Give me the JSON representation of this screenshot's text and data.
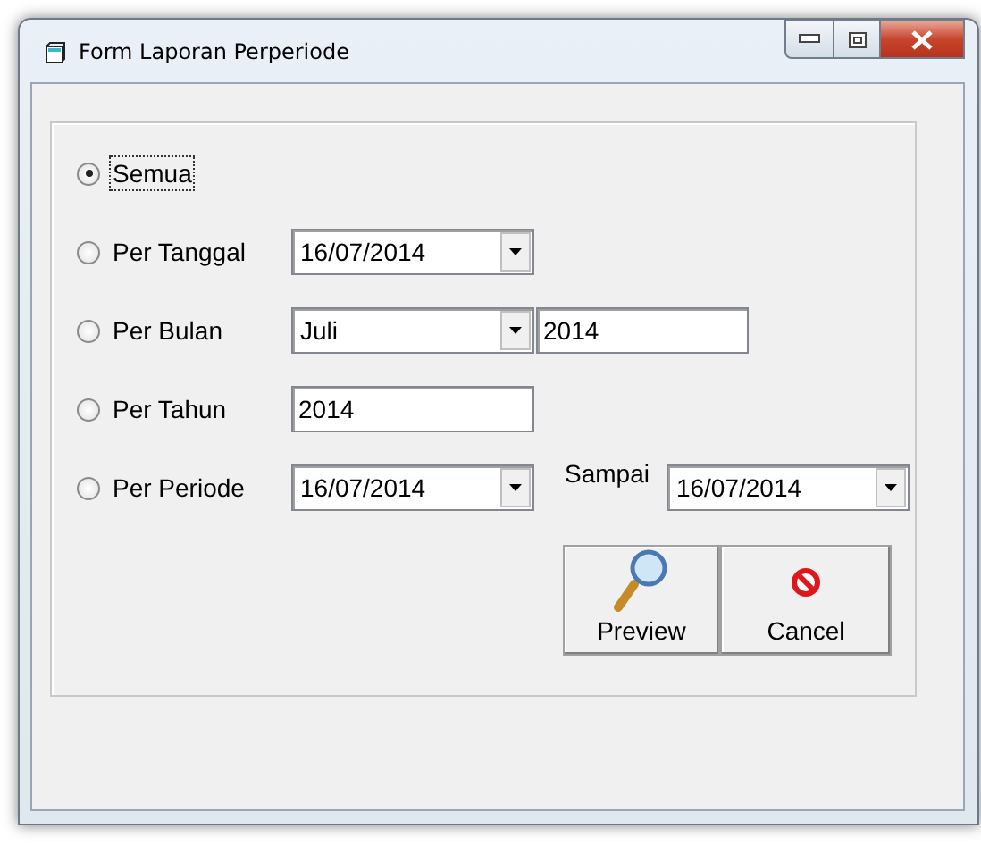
{
  "window": {
    "title": "Form Laporan Perperiode",
    "controls": [
      {
        "kind": "minimize"
      },
      {
        "kind": "maximize"
      },
      {
        "kind": "close"
      }
    ]
  },
  "options": [
    {
      "label": "Semua",
      "selected": true,
      "focused": true
    },
    {
      "label": "Per Tanggal",
      "selected": false,
      "focused": false,
      "fields": [
        {
          "kind": "combo",
          "value": "16/07/2014"
        }
      ]
    },
    {
      "label": "Per Bulan",
      "selected": false,
      "focused": false,
      "fields": [
        {
          "kind": "combo",
          "value": "Juli"
        },
        {
          "kind": "input",
          "value": "2014"
        }
      ]
    },
    {
      "label": "Per Tahun",
      "selected": false,
      "focused": false,
      "fields": [
        {
          "kind": "input",
          "value": "2014"
        }
      ]
    },
    {
      "label": "Per Periode",
      "selected": false,
      "focused": false,
      "fields": [
        {
          "kind": "combo",
          "value": "16/07/2014"
        },
        {
          "kind": "label",
          "value": "Sampai"
        },
        {
          "kind": "combo",
          "value": "16/07/2014"
        }
      ]
    }
  ],
  "buttons": [
    {
      "kind": "preview",
      "label": "Preview"
    },
    {
      "kind": "cancel",
      "label": "Cancel"
    }
  ]
}
